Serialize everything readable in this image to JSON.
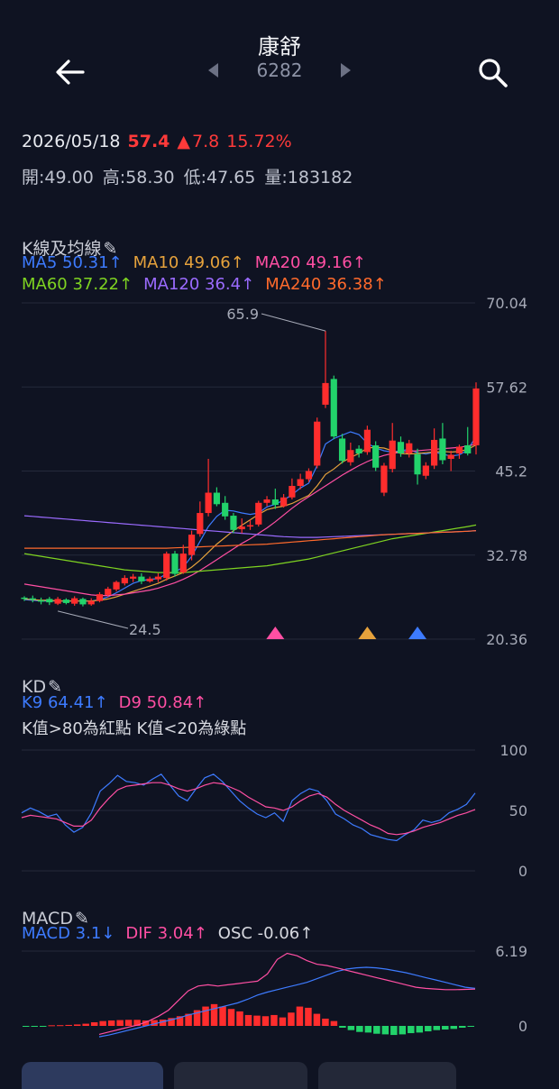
{
  "header": {
    "title": "康舒",
    "code": "6282",
    "icons": {
      "back": "arrow-left-icon",
      "prev": "triangle-left-icon",
      "next": "triangle-right-icon",
      "search": "search-icon"
    }
  },
  "quote": {
    "date": "2026/05/18",
    "price": "57.4",
    "change": "7.8",
    "change_pct": "15.72%",
    "open": "開:49.00",
    "high": "高:58.30",
    "low": "低:47.65",
    "volume": "量:183182",
    "up_color": "#ff3a3a"
  },
  "kline": {
    "title": "K線及均線",
    "ma": [
      {
        "text": "MA5 50.31↑",
        "color": "#3d7bff"
      },
      {
        "text": "MA10 49.06↑",
        "color": "#e6a23c"
      },
      {
        "text": "MA20 49.16↑",
        "color": "#ff4fa3"
      },
      {
        "text": "MA60 37.22↑",
        "color": "#7ed321"
      },
      {
        "text": "MA120 36.4↑",
        "color": "#9b6bff"
      },
      {
        "text": "MA240 36.38↑",
        "color": "#ff6a2c"
      }
    ],
    "y_axis": [
      "70.04",
      "57.62",
      "45.2",
      "32.78",
      "20.36"
    ],
    "max_label": "65.9",
    "min_label": "24.5"
  },
  "kd": {
    "title": "KD",
    "k": "K9 64.41↑",
    "d": "D9 50.84↑",
    "note": "K值>80為紅點 K值<20為綠點",
    "y_axis": [
      "100",
      "50",
      "0"
    ],
    "k_color": "#3d7bff",
    "d_color": "#ff4fa3"
  },
  "macd": {
    "title": "MACD",
    "macd": "MACD 3.1↓",
    "dif": "DIF 3.04↑",
    "osc": "OSC -0.06↑",
    "y_axis": [
      "6.19",
      "0"
    ]
  },
  "chart_data": [
    {
      "type": "candlestick",
      "title": "K線及均線",
      "ylim": [
        20.36,
        70.04
      ],
      "y_ticks": [
        70.04,
        57.62,
        45.2,
        32.78,
        20.36
      ],
      "annotations": [
        {
          "text": "65.9",
          "value": 65.9
        },
        {
          "text": "24.5",
          "value": 24.5
        }
      ],
      "candles": [
        [
          26.5,
          26.5,
          26,
          26.7,
          "g"
        ],
        [
          26.4,
          26.2,
          25.8,
          26.8,
          "g"
        ],
        [
          26.1,
          25.9,
          25.5,
          26.5,
          "g"
        ],
        [
          26.3,
          25.8,
          25.4,
          26.6,
          "g"
        ],
        [
          25.6,
          26.3,
          25.4,
          26.6,
          "r"
        ],
        [
          26.2,
          25.7,
          25.5,
          26.4,
          "g"
        ],
        [
          25.6,
          26.4,
          25.3,
          26.7,
          "r"
        ],
        [
          26.3,
          25.5,
          25.2,
          26.5,
          "g"
        ],
        [
          25.5,
          26.0,
          25.3,
          26.4,
          "r"
        ],
        [
          26.0,
          27.0,
          25.8,
          27.3,
          "r"
        ],
        [
          26.9,
          27.8,
          26.6,
          28.1,
          "r"
        ],
        [
          27.7,
          28.8,
          27.4,
          29.0,
          "r"
        ],
        [
          28.6,
          29.4,
          28.3,
          29.8,
          "r"
        ],
        [
          29.3,
          29.6,
          28.8,
          30.0,
          "r"
        ],
        [
          29.6,
          28.9,
          28.5,
          30.1,
          "g"
        ],
        [
          28.9,
          29.3,
          28.7,
          29.6,
          "r"
        ],
        [
          29.2,
          29.6,
          28.8,
          30.1,
          "r"
        ],
        [
          29.4,
          33.0,
          29.0,
          33.3,
          "r"
        ],
        [
          33.0,
          30.0,
          29.6,
          33.4,
          "g"
        ],
        [
          30.2,
          33.0,
          30.0,
          34.3,
          "r"
        ],
        [
          32.8,
          35.8,
          32.0,
          36.4,
          "r"
        ],
        [
          35.9,
          39.0,
          35.5,
          40.7,
          "r"
        ],
        [
          39.0,
          42.0,
          38.5,
          47.0,
          "r"
        ],
        [
          42.0,
          40.3,
          40.0,
          42.8,
          "g"
        ],
        [
          40.5,
          38.5,
          38.0,
          41.5,
          "g"
        ],
        [
          38.6,
          36.5,
          36.0,
          39.0,
          "g"
        ],
        [
          36.6,
          37.0,
          36.0,
          38.2,
          "r"
        ],
        [
          37.0,
          37.2,
          36.5,
          38.0,
          "r"
        ],
        [
          37.3,
          40.5,
          37.0,
          40.8,
          "r"
        ],
        [
          40.5,
          41.0,
          40.0,
          41.5,
          "r"
        ],
        [
          41.0,
          40.2,
          39.6,
          42.6,
          "g"
        ],
        [
          40.0,
          41.3,
          39.8,
          41.8,
          "r"
        ],
        [
          41.3,
          43.0,
          41.0,
          44.1,
          "r"
        ],
        [
          43.0,
          44.0,
          42.5,
          44.8,
          "r"
        ],
        [
          44.0,
          45.2,
          43.6,
          45.6,
          "r"
        ],
        [
          46.0,
          52.5,
          45.6,
          53.1,
          "r"
        ],
        [
          55.0,
          58.2,
          54.5,
          65.9,
          "r"
        ],
        [
          58.8,
          50.3,
          49.9,
          59.3,
          "g"
        ],
        [
          50.0,
          46.7,
          46.3,
          50.7,
          "g"
        ],
        [
          46.5,
          48.3,
          46.0,
          49.4,
          "r"
        ],
        [
          48.5,
          47.8,
          47.2,
          49.0,
          "g"
        ],
        [
          48.0,
          51.3,
          47.6,
          51.9,
          "r"
        ],
        [
          49.0,
          45.7,
          45.2,
          49.6,
          "g"
        ],
        [
          42.0,
          46.0,
          41.5,
          46.4,
          "r"
        ],
        [
          45.5,
          49.7,
          45.0,
          52.3,
          "r"
        ],
        [
          49.5,
          47.8,
          47.3,
          50.3,
          "g"
        ],
        [
          47.8,
          49.3,
          47.2,
          49.8,
          "r"
        ],
        [
          47.7,
          44.7,
          43.2,
          48.5,
          "g"
        ],
        [
          44.5,
          46.0,
          44.0,
          46.5,
          "r"
        ],
        [
          46.0,
          49.8,
          45.5,
          51.5,
          "r"
        ],
        [
          50.0,
          46.8,
          46.2,
          52.3,
          "g"
        ],
        [
          47.0,
          47.6,
          45.2,
          48.2,
          "r"
        ],
        [
          47.8,
          48.8,
          47.0,
          49.1,
          "r"
        ],
        [
          49.0,
          47.8,
          47.5,
          51.7,
          "g"
        ],
        [
          49.0,
          57.4,
          47.65,
          58.3,
          "r"
        ]
      ],
      "series": [
        {
          "name": "MA5",
          "color": "#3d7bff",
          "values": [
            26.2,
            26.1,
            26.0,
            26.0,
            26.0,
            26.0,
            26.0,
            26.0,
            26.0,
            26.2,
            26.6,
            27.2,
            27.9,
            28.6,
            29.0,
            29.2,
            29.3,
            30.0,
            30.3,
            31.0,
            32.6,
            34.8,
            37.0,
            38.5,
            39.4,
            39.3,
            39.0,
            38.8,
            39.0,
            39.9,
            40.3,
            40.9,
            41.7,
            42.7,
            43.4,
            46.0,
            49.2,
            50.0,
            50.5,
            51.0,
            50.6,
            49.3,
            48.6,
            48.2,
            48.0,
            48.2,
            48.4,
            47.9,
            47.7,
            48.0,
            47.7,
            47.4,
            47.6,
            48.3,
            50.31
          ]
        },
        {
          "name": "MA10",
          "color": "#e6a23c",
          "values": [
            26.3,
            26.2,
            26.1,
            26.1,
            26.0,
            26.0,
            26.0,
            26.0,
            26.0,
            26.1,
            26.3,
            26.6,
            27.0,
            27.4,
            27.8,
            28.2,
            28.6,
            29.2,
            29.7,
            30.2,
            31.0,
            32.0,
            33.2,
            34.4,
            35.4,
            36.4,
            37.2,
            38.0,
            38.8,
            39.5,
            39.8,
            40.0,
            40.4,
            41.0,
            41.6,
            43.0,
            44.7,
            45.5,
            46.5,
            47.2,
            47.8,
            48.6,
            48.7,
            48.6,
            48.2,
            47.8,
            47.7,
            47.8,
            47.9,
            48.0,
            48.1,
            48.0,
            48.1,
            48.4,
            49.06
          ]
        },
        {
          "name": "MA20",
          "color": "#ff4fa3",
          "values": [
            28.5,
            28.3,
            28.1,
            27.9,
            27.7,
            27.5,
            27.3,
            27.1,
            26.9,
            26.8,
            26.8,
            26.9,
            27.0,
            27.2,
            27.4,
            27.6,
            27.9,
            28.3,
            28.7,
            29.2,
            29.8,
            30.5,
            31.3,
            32.1,
            32.9,
            33.7,
            34.5,
            35.2,
            36.0,
            36.8,
            37.7,
            38.7,
            39.7,
            40.6,
            41.4,
            42.2,
            43.0,
            43.8,
            44.6,
            45.3,
            46.0,
            46.6,
            47.1,
            47.5,
            47.8,
            48.0,
            48.1,
            48.2,
            48.3,
            48.4,
            48.5,
            48.6,
            48.7,
            48.9,
            49.16
          ]
        },
        {
          "name": "MA60",
          "color": "#7ed321",
          "values": [
            33.0,
            32.8,
            32.6,
            32.4,
            32.2,
            32.0,
            31.8,
            31.6,
            31.4,
            31.2,
            31.0,
            30.8,
            30.6,
            30.5,
            30.4,
            30.3,
            30.2,
            30.2,
            30.2,
            30.2,
            30.3,
            30.4,
            30.5,
            30.6,
            30.7,
            30.8,
            30.9,
            31.0,
            31.1,
            31.2,
            31.4,
            31.6,
            31.8,
            32.0,
            32.2,
            32.5,
            32.8,
            33.1,
            33.4,
            33.7,
            34.0,
            34.3,
            34.6,
            34.9,
            35.2,
            35.4,
            35.6,
            35.8,
            36.0,
            36.2,
            36.4,
            36.6,
            36.8,
            37.0,
            37.22
          ]
        },
        {
          "name": "MA120",
          "color": "#9b6bff",
          "values": [
            38.6,
            38.5,
            38.4,
            38.3,
            38.2,
            38.1,
            38.0,
            37.9,
            37.8,
            37.7,
            37.6,
            37.5,
            37.4,
            37.3,
            37.2,
            37.1,
            37.0,
            36.9,
            36.8,
            36.7,
            36.6,
            36.5,
            36.4,
            36.3,
            36.2,
            36.1,
            36.0,
            35.9,
            35.8,
            35.7,
            35.6,
            35.5,
            35.45,
            35.4,
            35.4,
            35.4,
            35.45,
            35.5,
            35.55,
            35.6,
            35.65,
            35.7,
            35.75,
            35.8,
            35.85,
            35.9,
            35.95,
            36.0,
            36.05,
            36.1,
            36.15,
            36.2,
            36.25,
            36.3,
            36.4
          ]
        },
        {
          "name": "MA240",
          "color": "#ff6a2c",
          "values": [
            33.8,
            33.8,
            33.8,
            33.8,
            33.8,
            33.8,
            33.8,
            33.8,
            33.8,
            33.8,
            33.8,
            33.8,
            33.8,
            33.8,
            33.8,
            33.8,
            33.8,
            33.8,
            33.85,
            33.9,
            33.95,
            34.0,
            34.05,
            34.1,
            34.15,
            34.2,
            34.25,
            34.3,
            34.35,
            34.4,
            34.5,
            34.6,
            34.7,
            34.8,
            34.9,
            35.0,
            35.1,
            35.2,
            35.3,
            35.4,
            35.5,
            35.6,
            35.7,
            35.8,
            35.85,
            35.9,
            35.95,
            36.0,
            36.05,
            36.1,
            36.15,
            36.2,
            36.25,
            36.3,
            36.38
          ]
        }
      ],
      "markers": [
        {
          "index": 30,
          "color": "#ff4fa3"
        },
        {
          "index": 41,
          "color": "#e6a23c"
        },
        {
          "index": 47,
          "color": "#3d7bff"
        }
      ]
    },
    {
      "type": "line",
      "title": "KD",
      "ylim": [
        0,
        100
      ],
      "y_ticks": [
        100,
        50,
        0
      ],
      "series": [
        {
          "name": "K9",
          "color": "#3d7bff",
          "values": [
            48,
            52,
            49,
            45,
            47,
            38,
            32,
            36,
            48,
            66,
            72,
            79,
            74,
            73,
            71,
            76,
            80,
            71,
            62,
            58,
            68,
            77,
            80,
            74,
            66,
            58,
            52,
            47,
            44,
            48,
            41,
            58,
            64,
            68,
            66,
            58,
            47,
            43,
            38,
            35,
            30,
            28,
            26,
            25,
            30,
            34,
            42,
            40,
            42,
            48,
            51,
            55,
            64.41
          ]
        },
        {
          "name": "D9",
          "color": "#ff4fa3",
          "values": [
            44,
            46,
            45,
            44,
            43,
            40,
            37,
            37,
            42,
            52,
            60,
            67,
            70,
            71,
            72,
            73,
            73,
            71,
            68,
            66,
            68,
            71,
            73,
            72,
            69,
            66,
            61,
            57,
            53,
            52,
            50,
            53,
            58,
            62,
            64,
            61,
            55,
            50,
            46,
            42,
            38,
            35,
            31,
            30,
            31,
            33,
            36,
            38,
            40,
            43,
            46,
            48,
            50.84
          ]
        }
      ]
    },
    {
      "type": "bar",
      "title": "MACD",
      "ylim": [
        -0.9,
        6.19
      ],
      "y_ticks": [
        6.19,
        0
      ],
      "osc_values": [
        -0.05,
        -0.05,
        -0.05,
        0.05,
        0.06,
        0.08,
        0.12,
        0.18,
        0.3,
        0.4,
        0.45,
        0.48,
        0.5,
        0.5,
        0.45,
        0.48,
        0.52,
        0.65,
        0.8,
        1.0,
        1.3,
        1.6,
        1.8,
        1.6,
        1.4,
        1.2,
        0.9,
        0.85,
        0.8,
        0.9,
        0.7,
        1.1,
        1.6,
        1.5,
        1.0,
        0.6,
        0.4,
        -0.15,
        -0.35,
        -0.5,
        -0.55,
        -0.65,
        -0.7,
        -0.75,
        -0.7,
        -0.6,
        -0.55,
        -0.45,
        -0.35,
        -0.3,
        -0.25,
        -0.15,
        -0.06
      ],
      "series": [
        {
          "name": "MACD",
          "color": "#3d7bff",
          "values": [
            -0.9,
            -0.75,
            -0.55,
            -0.35,
            -0.15,
            0.05,
            0.25,
            0.45,
            0.65,
            0.9,
            1.1,
            1.3,
            1.5,
            1.7,
            1.9,
            2.2,
            2.55,
            2.8,
            3.0,
            3.2,
            3.4,
            3.6,
            3.9,
            4.2,
            4.5,
            4.7,
            4.8,
            4.85,
            4.8,
            4.7,
            4.55,
            4.4,
            4.2,
            4.0,
            3.8,
            3.6,
            3.4,
            3.2,
            3.1
          ]
        },
        {
          "name": "DIF",
          "color": "#ff4fa3",
          "values": [
            -0.7,
            -0.5,
            -0.3,
            -0.1,
            0.1,
            0.4,
            0.8,
            1.3,
            2.1,
            2.9,
            3.3,
            3.4,
            3.3,
            3.4,
            3.5,
            3.6,
            3.7,
            4.3,
            5.5,
            6.0,
            5.8,
            5.4,
            5.1,
            5.0,
            4.8,
            4.6,
            4.4,
            4.2,
            4.0,
            3.8,
            3.6,
            3.4,
            3.2,
            3.1,
            3.05,
            3.0,
            3.0,
            3.02,
            3.04
          ]
        }
      ]
    }
  ]
}
